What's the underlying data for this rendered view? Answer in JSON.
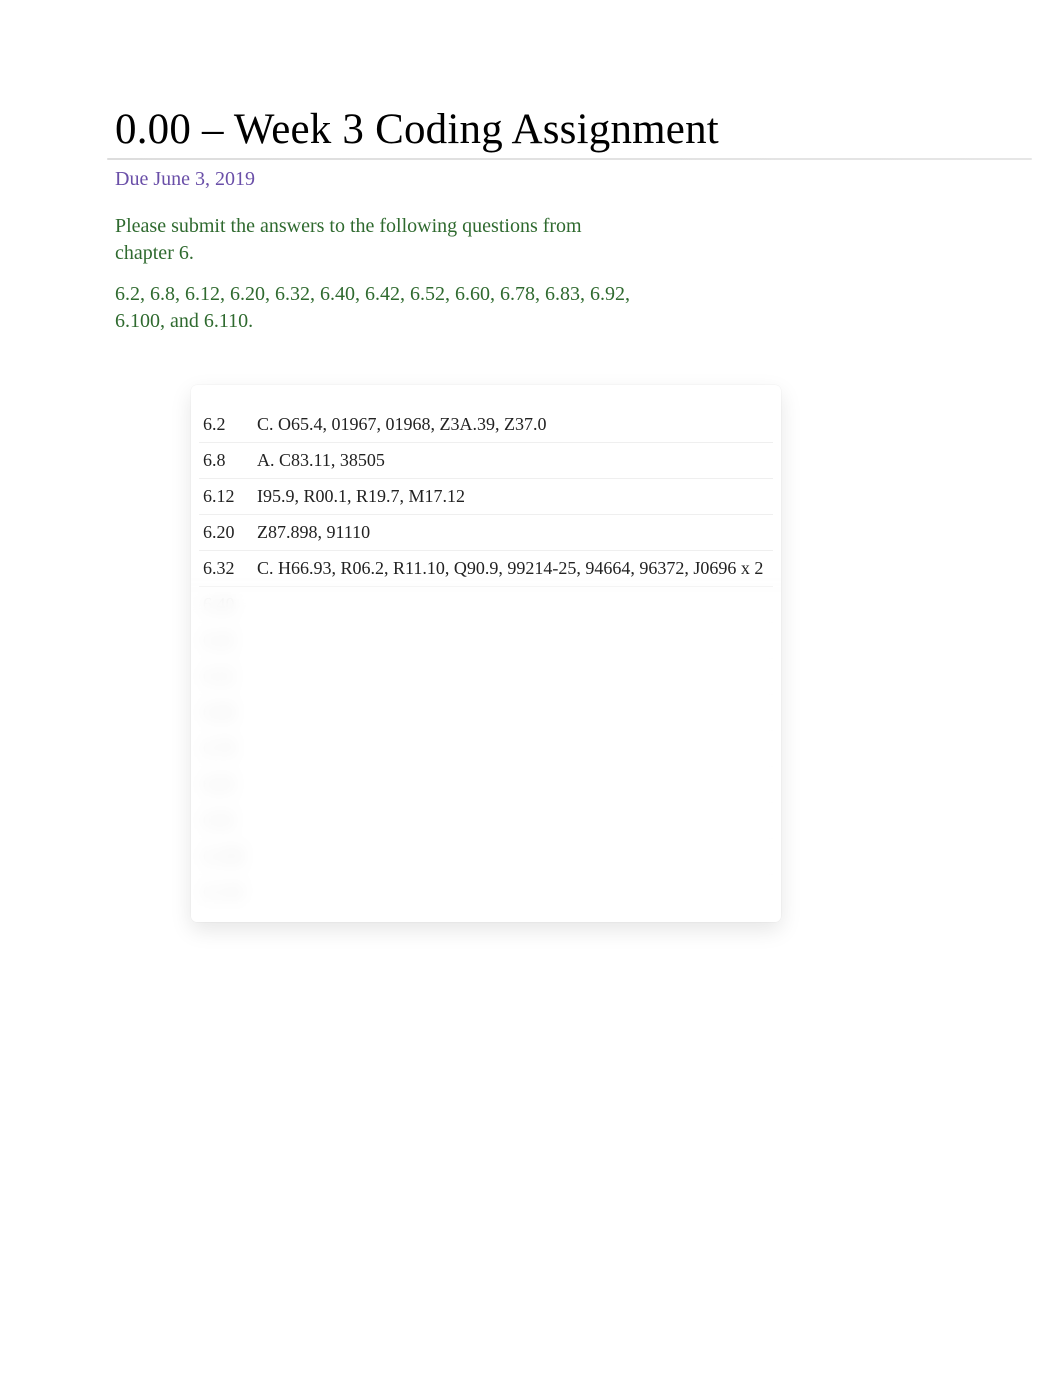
{
  "header": {
    "title": "0.00 – Week 3 Coding Assignment",
    "due": "Due June 3, 2019"
  },
  "instructions": "Please submit the answers to the following questions from chapter 6.",
  "question_list": "6.2, 6.8, 6.12, 6.20, 6.32, 6.40, 6.42, 6.52, 6.60, 6.78, 6.83, 6.92, 6.100, and 6.110.",
  "answers": {
    "visible": [
      {
        "q": "6.2",
        "a": "C. O65.4, 01967, 01968, Z3A.39, Z37.0"
      },
      {
        "q": "6.8",
        "a": "A. C83.11, 38505"
      },
      {
        "q": "6.12",
        "a": "I95.9, R00.1, R19.7, M17.12"
      },
      {
        "q": "6.20",
        "a": "Z87.898, 91110"
      },
      {
        "q": "6.32",
        "a": "C. H66.93, R06.2, R11.10, Q90.9, 99214-25, 94664, 96372, J0696 x 2"
      }
    ],
    "hidden": [
      {
        "q": "6.40",
        "a": ""
      },
      {
        "q": "6.42",
        "a": ""
      },
      {
        "q": "6.52",
        "a": ""
      },
      {
        "q": "6.60",
        "a": ""
      },
      {
        "q": "6.78",
        "a": ""
      },
      {
        "q": "6.83",
        "a": ""
      },
      {
        "q": "6.92",
        "a": ""
      },
      {
        "q": "6.100",
        "a": ""
      },
      {
        "q": "6.110",
        "a": ""
      }
    ]
  }
}
